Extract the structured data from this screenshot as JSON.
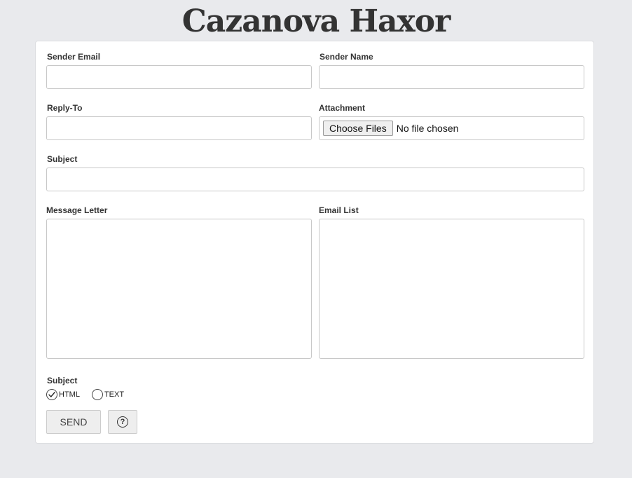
{
  "header": {
    "title": "Cazanova Haxor"
  },
  "form": {
    "sender_email": {
      "label": "Sender Email",
      "value": ""
    },
    "sender_name": {
      "label": "Sender Name",
      "value": ""
    },
    "reply_to": {
      "label": "Reply-To",
      "value": ""
    },
    "attachment": {
      "label": "Attachment",
      "button_label": "Choose Files",
      "status": "No file chosen"
    },
    "subject": {
      "label": "Subject",
      "value": ""
    },
    "message_letter": {
      "label": "Message Letter",
      "value": ""
    },
    "email_list": {
      "label": "Email List",
      "value": ""
    },
    "format": {
      "label": "Subject",
      "options": [
        {
          "label": "HTML",
          "selected": true
        },
        {
          "label": "TEXT",
          "selected": false
        }
      ]
    },
    "send_label": "SEND",
    "help_symbol": "?",
    "colors": {
      "background": "#e9eaed",
      "card": "#ffffff",
      "border": "#c8c8c8",
      "text": "#333333",
      "button": "#eeeeee"
    }
  }
}
